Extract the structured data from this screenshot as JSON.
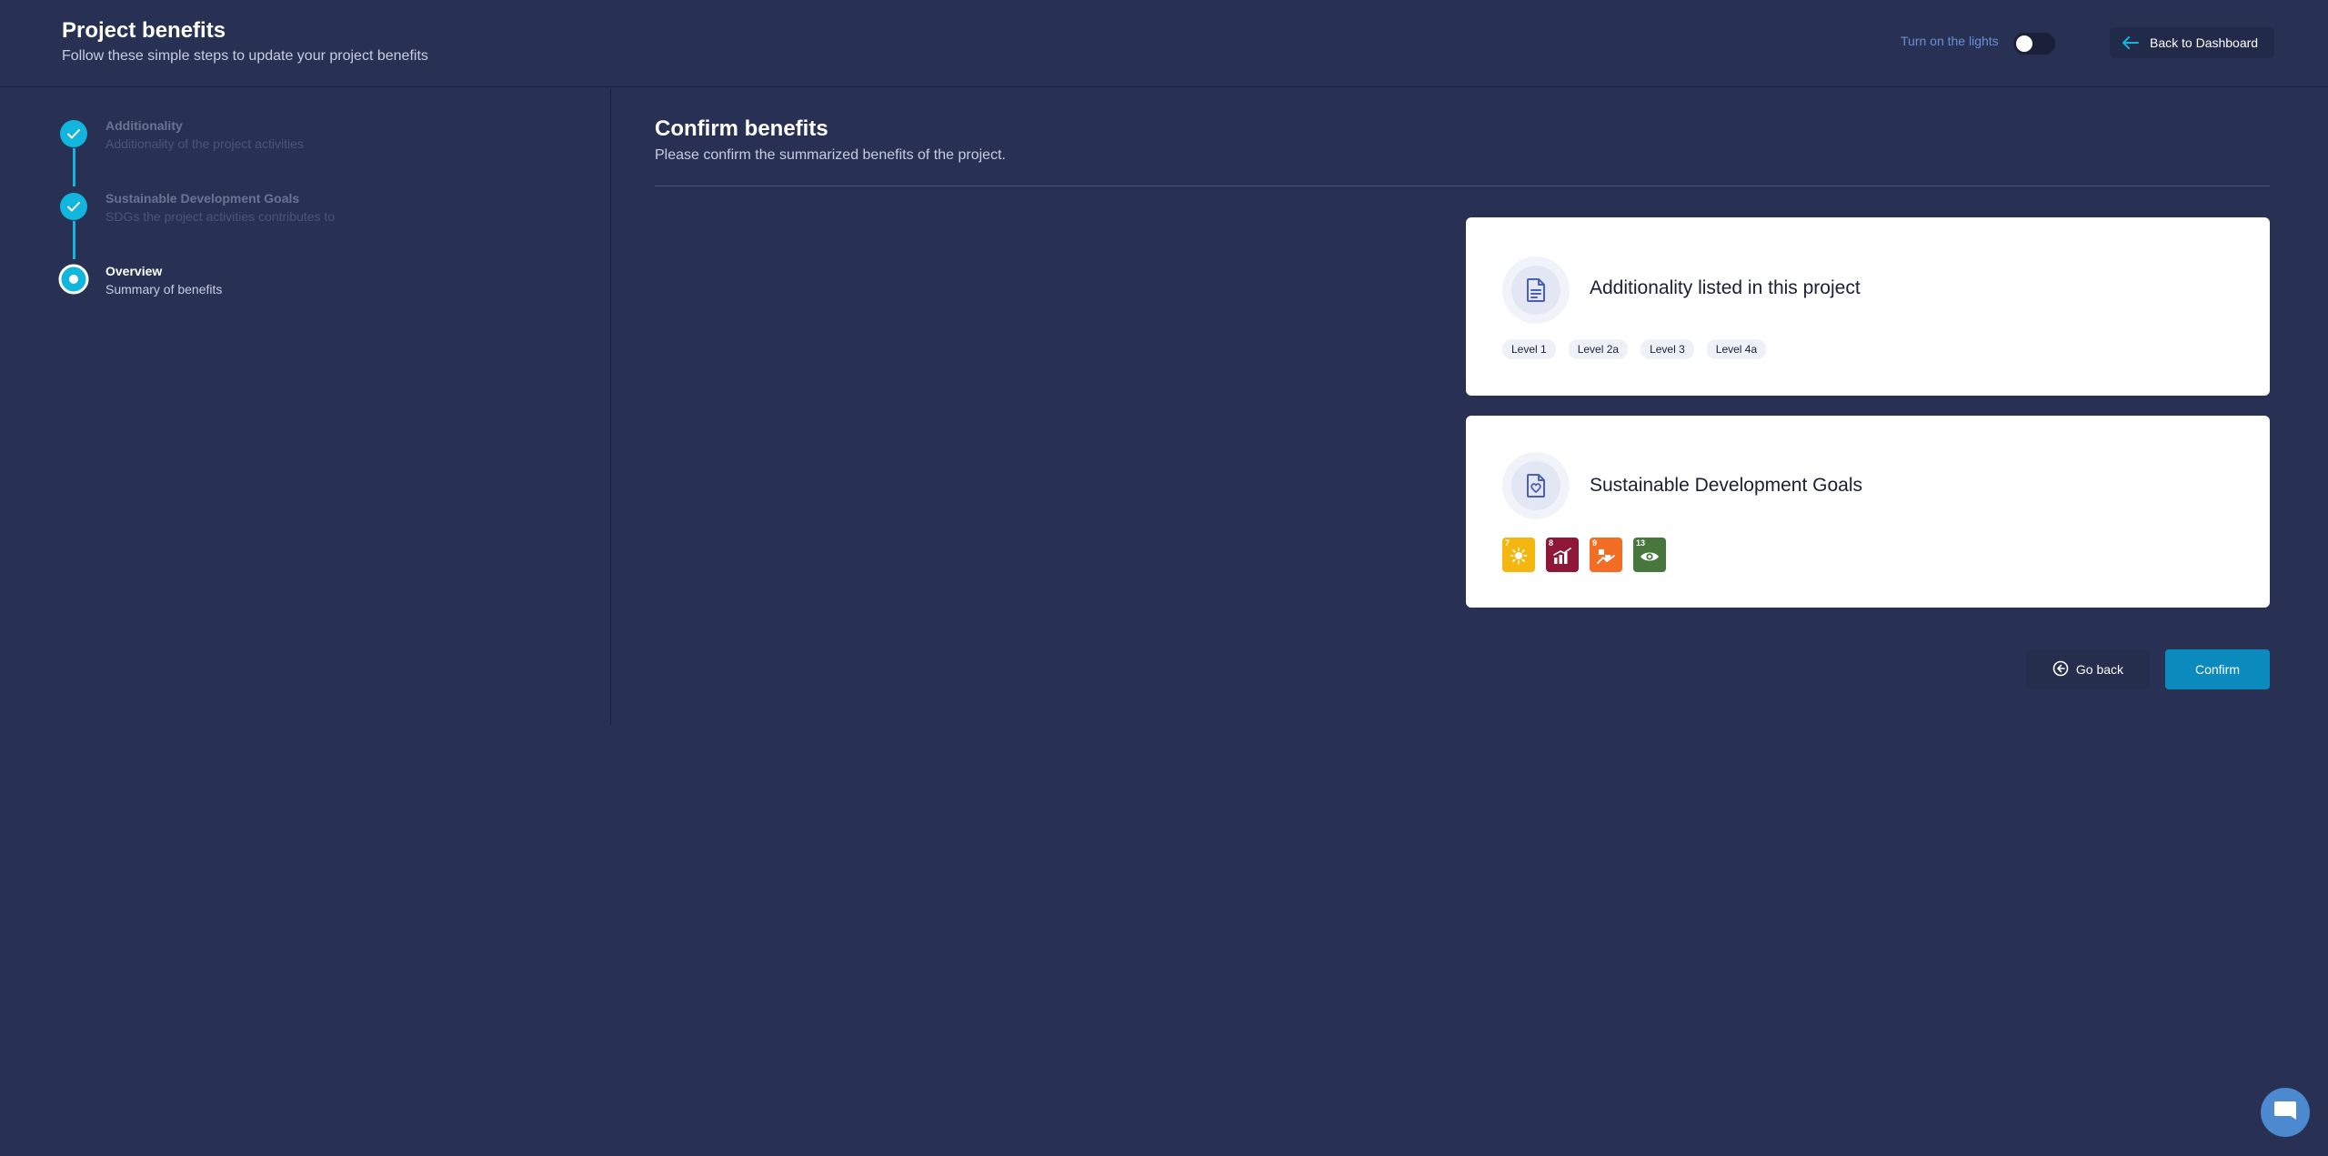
{
  "header": {
    "title": "Project benefits",
    "subtitle": "Follow these simple steps to update your project benefits",
    "lights_label": "Turn on the lights",
    "back_label": "Back to Dashboard"
  },
  "steps": [
    {
      "title": "Additionality",
      "desc": "Additionality of the project activities",
      "state": "done"
    },
    {
      "title": "Sustainable Development Goals",
      "desc": "SDGs the project activities contributes to",
      "state": "done"
    },
    {
      "title": "Overview",
      "desc": "Summary of benefits",
      "state": "active"
    }
  ],
  "main": {
    "title": "Confirm benefits",
    "subtitle": "Please confirm the summarized benefits of the project."
  },
  "additionality_card": {
    "title": "Additionality listed in this project",
    "chips": [
      "Level 1",
      "Level 2a",
      "Level 3",
      "Level 4a"
    ]
  },
  "sdg_card": {
    "title": "Sustainable Development Goals",
    "goals": [
      {
        "number": "7",
        "color": "#f5b70f",
        "icon": "sun-icon"
      },
      {
        "number": "8",
        "color": "#8f1838",
        "icon": "growth-chart-icon"
      },
      {
        "number": "9",
        "color": "#f36d25",
        "icon": "industry-icon"
      },
      {
        "number": "13",
        "color": "#48773e",
        "icon": "eye-earth-icon"
      }
    ]
  },
  "actions": {
    "go_back": "Go back",
    "confirm": "Confirm"
  },
  "colors": {
    "background": "#283154",
    "accent": "#12b5dc",
    "confirm": "#0b8bbd"
  }
}
